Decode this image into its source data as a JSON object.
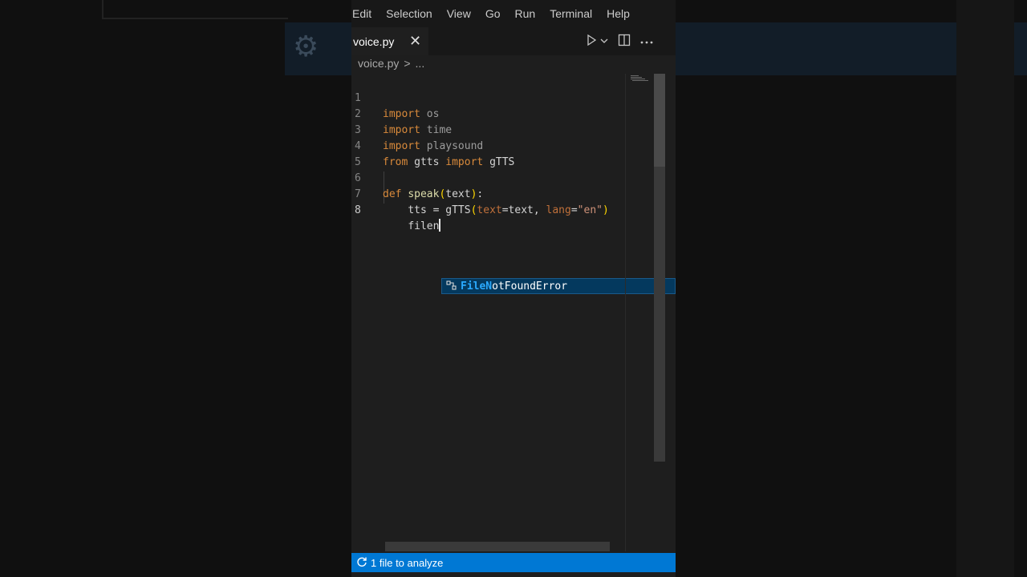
{
  "menu": [
    "Edit",
    "Selection",
    "View",
    "Go",
    "Run",
    "Terminal",
    "Help"
  ],
  "tab": {
    "label": "voice.py",
    "close_icon": "close-icon"
  },
  "tab_actions": [
    "run-icon",
    "chevron-down-icon",
    "split-editor-icon",
    "more-icon"
  ],
  "breadcrumb": {
    "file": "voice.py",
    "separator": ">",
    "rest": "..."
  },
  "code_lines": [
    {
      "num": "1",
      "text": "import os"
    },
    {
      "num": "2",
      "text": "import time"
    },
    {
      "num": "3",
      "text": "import playsound"
    },
    {
      "num": "4",
      "text": "from gtts import gTTS"
    },
    {
      "num": "5",
      "text": ""
    },
    {
      "num": "6",
      "text": "def speak(text):"
    },
    {
      "num": "7",
      "text": "tts = gTTS(text=text, lang=\"en\")"
    },
    {
      "num": "8",
      "text": "filen"
    }
  ],
  "suggestion": {
    "icon": "class-icon",
    "match": "FileN",
    "rest": "otFoundError"
  },
  "status": {
    "icon": "sync-icon",
    "label": "1 file to analyze"
  },
  "colors": {
    "statusbar": "#0078d4",
    "suggest_bg": "#04395e",
    "keyword": "#c586c0"
  }
}
